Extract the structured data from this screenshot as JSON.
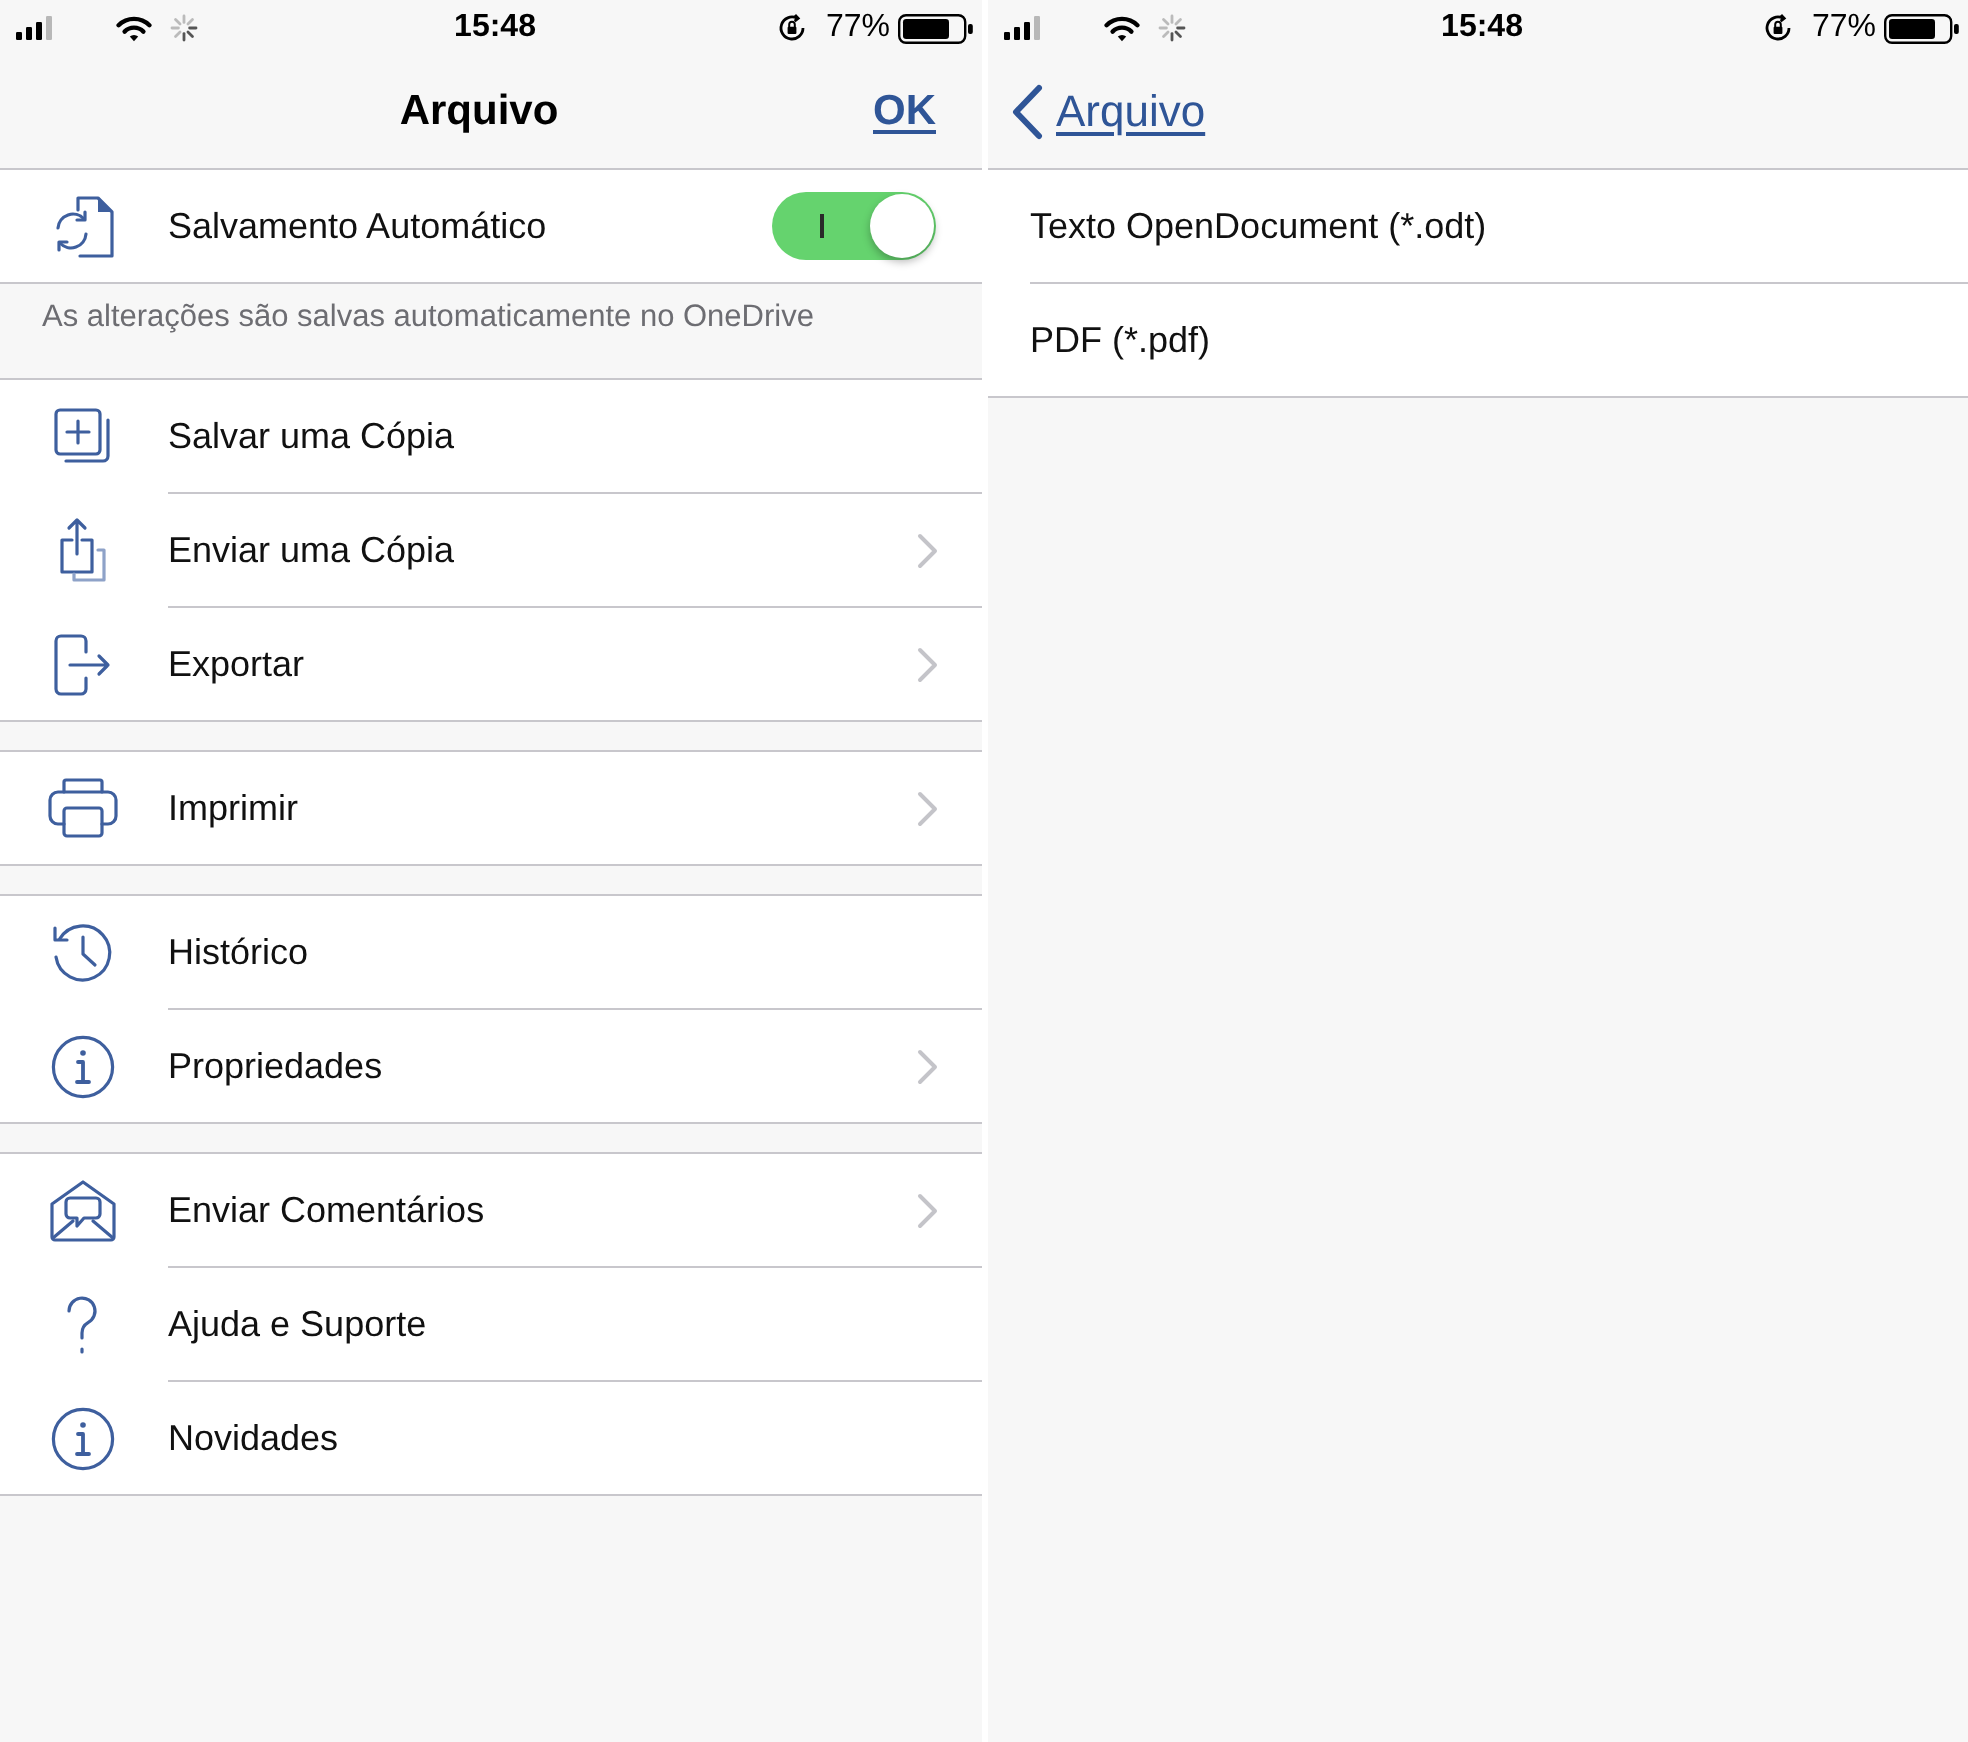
{
  "file_screen": {
    "status_bar": {
      "time": "15:48",
      "battery": "77%"
    },
    "nav_bar": {
      "title": "Arquivo",
      "ok_link": "OK"
    },
    "autosave": {
      "label": "Salvamento Automático",
      "on": true
    },
    "autosave_note": "As alterações são salvas automaticamente no OneDrive",
    "menu_groups": [
      {
        "items": [
          {
            "label": "Salvar uma Cópia",
            "has_submenu": false
          },
          {
            "label": "Enviar uma Cópia",
            "has_submenu": true
          },
          {
            "label": "Exportar",
            "has_submenu": true
          }
        ]
      },
      {
        "items": [
          {
            "label": "Imprimir",
            "has_submenu": true
          }
        ]
      },
      {
        "items": [
          {
            "label": "Histórico",
            "has_submenu": false
          },
          {
            "label": "Propriedades",
            "has_submenu": true
          }
        ]
      },
      {
        "items": [
          {
            "label": "Enviar Comentários",
            "has_submenu": true
          },
          {
            "label": "Ajuda e Suporte",
            "has_submenu": false
          },
          {
            "label": "Novidades",
            "has_submenu": false
          }
        ]
      }
    ]
  },
  "export_screen": {
    "status_bar": {
      "time": "15:48",
      "battery": "77%"
    },
    "nav_bar": {
      "back_link": "Arquivo"
    },
    "formats": [
      "Texto OpenDocument (*.odt)",
      "PDF (*.pdf)"
    ]
  }
}
